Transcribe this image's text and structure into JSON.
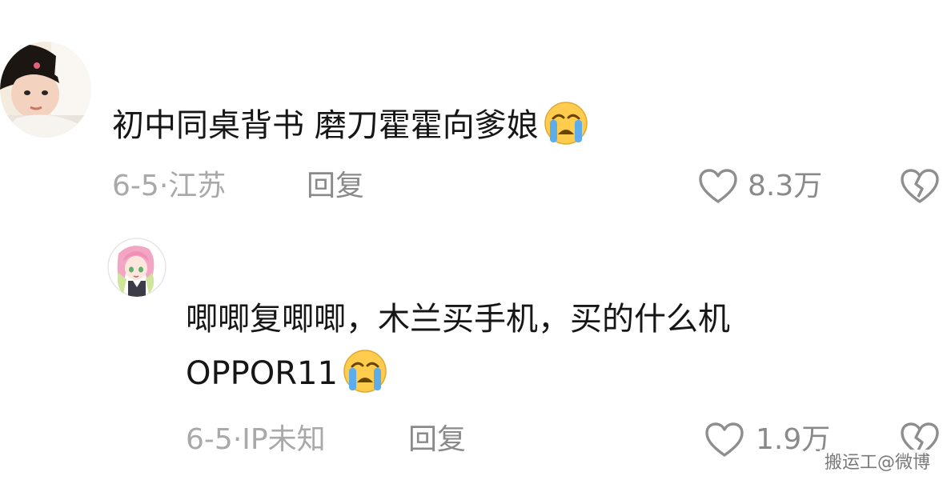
{
  "comments": [
    {
      "text": "初中同桌背书 磨刀霍霍向爹娘",
      "emoji": "loudly-crying-emoji",
      "date": "6-5",
      "location": "江苏",
      "reply_label": "回复",
      "like_count": "8.3万"
    },
    {
      "text_line1": "唧唧复唧唧，木兰买手机，买的什么机",
      "text_line2": "OPPOR11",
      "emoji": "loudly-crying-emoji",
      "date": "6-5",
      "location": "IP未知",
      "reply_label": "回复",
      "like_count": "1.9万"
    }
  ],
  "watermark": "搬运工@微博",
  "colors": {
    "text": "#161616",
    "meta": "#a9a9a9",
    "action": "#8a8a8a",
    "icon_stroke": "#8e8e8e",
    "emoji_face": "#ffcc4d",
    "emoji_tear": "#5dadec"
  }
}
